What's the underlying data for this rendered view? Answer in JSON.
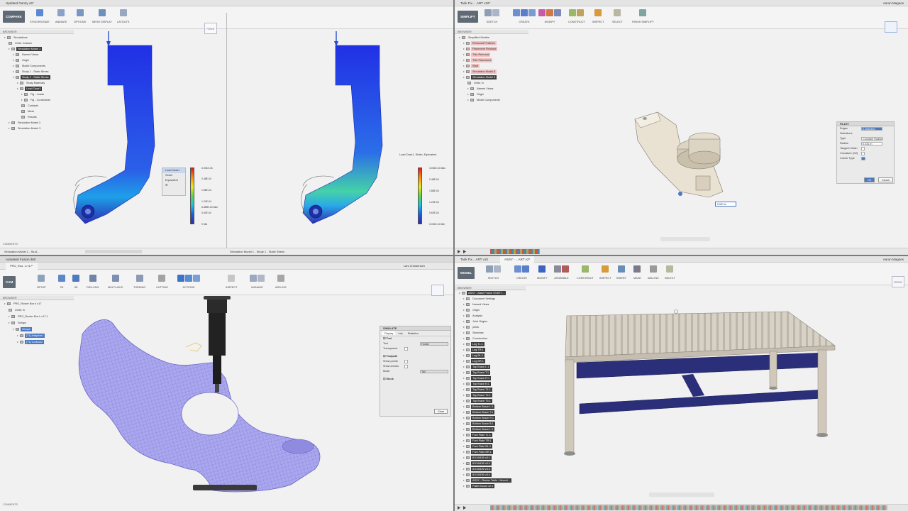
{
  "q1": {
    "title": "Updated Gantry v6*",
    "workspace": "COMPARE",
    "toolbar": [
      "SYNCHRONIZE",
      "ANIMATE",
      "OPTIONS",
      "MESH DISPLAY",
      "LAYOUTS"
    ],
    "browser_label": "BROWSER",
    "tree": [
      "Simulations",
      "Units: Custom",
      "Simulation Model 1",
      "Named Views",
      "Origin",
      "Model Components",
      "Study 1 - Static Stress",
      "Study 2 - Static Stress",
      "Study Materials",
      "Load Case1",
      "Fig - Loads",
      "Fig - Constraints",
      "Contacts",
      "Mesh",
      "Results",
      "Simulation Model 2",
      "Simulation Model 3"
    ],
    "comments_label": "COMMENTS",
    "status_left": "Simulation Model 1 - Stud...",
    "status_right": "Simulation Model 1 - Study 1 - Static Stress",
    "viewcube": "FRONT",
    "legend_panel": [
      "Load Case1",
      "Strain",
      "Equivalent"
    ],
    "legend_left": [
      "3.001E-04",
      "2.48E-04",
      "1.86E-04",
      "1.24E-04",
      "6.889E-04 Max",
      "0.62E-04",
      "0 Min"
    ],
    "legend_right_title": "Load Case1, Strain, Equivalent",
    "legend_right": [
      "3.001E-04 Max",
      "2.48E-04",
      "1.86E-04",
      "1.24E-04",
      "0.62E-04",
      "0.001E-04 Min"
    ]
  },
  "q2": {
    "title": "Tank Fix... .ART v10*",
    "workspace": "SIMPLIFY",
    "toolbar": [
      "SKETCH",
      "CREATE",
      "MODIFY",
      "CONSTRUCT",
      "INSPECT",
      "SELECT",
      "FINISH SIMPLIFY"
    ],
    "browser_label": "BROWSER",
    "tree": [
      "Simplified Models",
      "Removed Finished",
      "Placement Finished",
      "Thin Removal",
      "Thin Placement",
      "Start",
      "Simulation Model 8",
      "Simulation Model 9",
      "Units: in",
      "Named Views",
      "Origin",
      "Model Components"
    ],
    "fillet": {
      "header": "FILLET",
      "rows": [
        [
          "Edges",
          "2 selected"
        ],
        [
          "Selections",
          ""
        ],
        [
          "Type",
          "Constant Radius"
        ],
        [
          "Radius",
          "0.031 in"
        ],
        [
          "Tangent Chain",
          ""
        ],
        [
          "Curvature (G2)",
          ""
        ],
        [
          "Corner Type",
          ""
        ]
      ],
      "ok": "OK",
      "cancel": "Cancel"
    },
    "dim_input": "0.031 in",
    "user": "Aaron Magnes"
  },
  "q3": {
    "app_title": "Autodesk Fusion 360",
    "tab": "PRO_Rou...k v17*",
    "user": "Lars Christensen",
    "workspace": "CAM",
    "toolbar": [
      "SETUP",
      "2D",
      "3D",
      "DRILLING",
      "MULTI-AXIS",
      "TURNING",
      "CUTTING",
      "ACTIONS",
      "INSPECT",
      "MANAGE",
      "ADD-INS"
    ],
    "browser_label": "BROWSER",
    "tree": [
      "PRO_Router Box k v17",
      "Units: in",
      "PRO_Router Box k v17.1",
      "Setups",
      "Setup1",
      "[T1] Adaptive1",
      "[T1] Contour2"
    ],
    "simulate": {
      "header": "SIMULATE",
      "tabs": [
        "Display",
        "Info",
        "Statistics"
      ],
      "tool_section": "Tool",
      "tool_rows": [
        [
          "Tool",
          "Holder"
        ],
        [
          "Transparent",
          ""
        ]
      ],
      "toolpath_section": "Toolpath",
      "toolpath_rows": [
        [
          "Show points",
          ""
        ],
        [
          "Show arrows",
          ""
        ],
        [
          "Mode",
          "Tail"
        ]
      ],
      "stock_section": "Stock",
      "close": "Close"
    },
    "comments_label": "COMMENTS"
  },
  "q4": {
    "title": "Tank Fix... ART v10",
    "tab2": "ASSY - ...ART v2*",
    "user": "Aaron Magnes",
    "workspace": "MODEL",
    "toolbar": [
      "SKETCH",
      "CREATE",
      "MODIFY",
      "ASSEMBLE",
      "CONSTRUCT",
      "INSPECT",
      "INSERT",
      "MAKE",
      "ADD-INS",
      "SELECT"
    ],
    "browser_label": "BROWSER",
    "tree": [
      "ASSY - Base Frame START ...",
      "Document Settings",
      "Named Views",
      "Origin",
      "Analysis",
      "Joint Origins",
      "joints",
      "Sketches",
      "Construction",
      "Leg TL:1",
      "Leg TR:1",
      "Leg BL:1",
      "Leg BR:1",
      "Top Brace L:1",
      "Top Brace T:1",
      "Top Brace R:1",
      "Top Brace B:1",
      "Top Brace T1:1",
      "Top Brace T2:1",
      "Top Brace T3:1",
      "Bottom Brace L:1",
      "Bottom Brace T:1",
      "Bottom Brace R:1",
      "Bottom Brace B:1",
      "Bottom Brace L:1",
      "Foot Plate TL:1",
      "Foot Plate TR:1",
      "Foot Plate BL:1",
      "Foot Plate BR:1",
      "8/11/8436 v8:1",
      "8/11/8436 v8:2",
      "8/11/8436 v8:3",
      "8/11/8436 v8:4",
      "ASSY - Router Table - Mounti...",
      "Pallet Mount v2:1"
    ],
    "viewcube": "FRONT"
  },
  "colors": {
    "accent": "#4a78c2",
    "stress_blue": "#1b4fe0",
    "frame_blue": "#2b2f7a",
    "table_top": "#d7d1c6",
    "part_beige": "#e9e2d3",
    "cam_part": "#a9a6ee"
  }
}
